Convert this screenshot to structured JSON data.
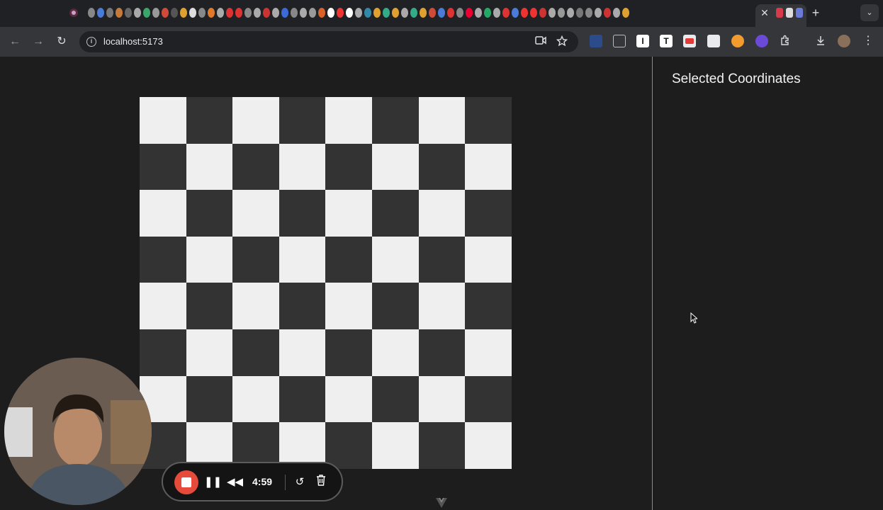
{
  "browser": {
    "url": "localhost:5173",
    "tab_close": "✕",
    "new_tab": "+",
    "tab_menu": "⌄",
    "nav": {
      "back": "←",
      "forward": "→",
      "reload": "↻"
    },
    "omnibox_icons": [
      "camera-icon",
      "star-icon"
    ],
    "extensions": [
      "extension-chart-icon",
      "extension-reader-icon",
      "extension-i-icon",
      "extension-t-icon",
      "extension-pdf-icon",
      "extension-edit-icon",
      "extension-orange-icon",
      "extension-purple-icon",
      "extensions-puzzle-icon",
      "download-icon",
      "profile-avatar",
      "menu-icon"
    ]
  },
  "page": {
    "side_title": "Selected Coordinates"
  },
  "board": {
    "size": 8,
    "light_color": "#efefef",
    "dark_color": "#333333",
    "top_left": "light"
  },
  "recorder": {
    "time": "4:59",
    "stop_color": "#e64a3b"
  }
}
